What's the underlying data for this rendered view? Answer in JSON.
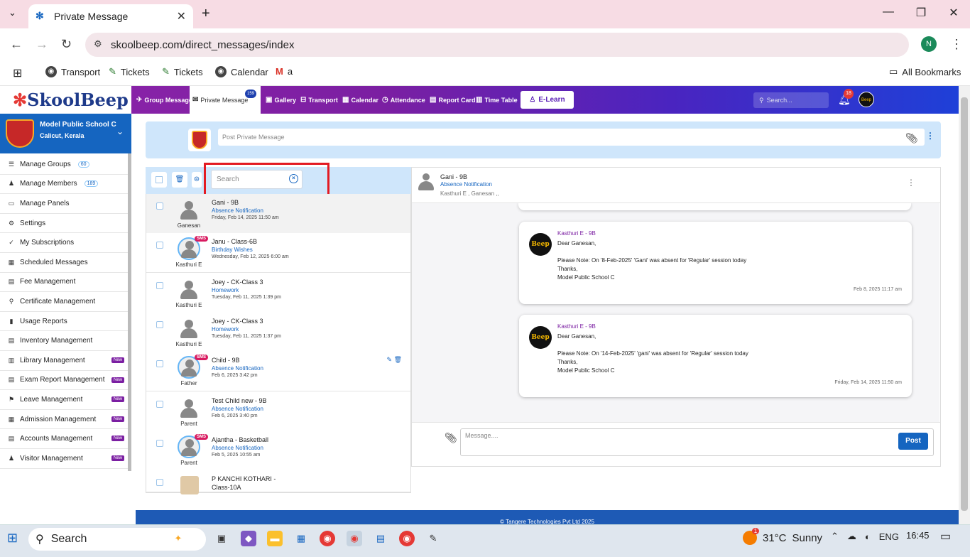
{
  "browser": {
    "tab_title": "Private Message",
    "url": "skoolbeep.com/direct_messages/index",
    "profile_initial": "N",
    "bookmarks": [
      "Transport",
      "Tickets",
      "Tickets",
      "Calendar",
      "a"
    ],
    "all_bookmarks": "All Bookmarks"
  },
  "app": {
    "logo_k": "✻",
    "logo_text": "SkoolBeep",
    "nav": [
      {
        "icon": "✈",
        "label": "Group Message"
      },
      {
        "icon": "✉",
        "label": "Private Message",
        "badge": "159"
      },
      {
        "icon": "▣",
        "label": "Gallery"
      },
      {
        "icon": "⊟",
        "label": "Transport"
      },
      {
        "icon": "▦",
        "label": "Calendar"
      },
      {
        "icon": "◷",
        "label": "Attendance"
      },
      {
        "icon": "▤",
        "label": "Report Card"
      },
      {
        "icon": "▥",
        "label": "Time Table"
      }
    ],
    "elearn": "E-Learn",
    "search_placeholder": "Search...",
    "notif_count": "18",
    "avatar_text": "Beep"
  },
  "school": {
    "name": "Model Public School C",
    "location": "Calicut, Kerala"
  },
  "sidebar": [
    {
      "icon": "☰",
      "label": "Manage Groups",
      "count": "60"
    },
    {
      "icon": "♟",
      "label": "Manage Members",
      "count": "189"
    },
    {
      "icon": "▭",
      "label": "Manage Panels"
    },
    {
      "icon": "⚙",
      "label": "Settings"
    },
    {
      "icon": "✓",
      "label": "My Subscriptions"
    },
    {
      "icon": "▦",
      "label": "Scheduled Messages"
    },
    {
      "icon": "▤",
      "label": "Fee Management"
    },
    {
      "icon": "⚲",
      "label": "Certificate Management"
    },
    {
      "icon": "▮",
      "label": "Usage Reports"
    },
    {
      "icon": "▤",
      "label": "Inventory Management"
    },
    {
      "icon": "▥",
      "label": "Library Management",
      "new": "New"
    },
    {
      "icon": "▤",
      "label": "Exam Report Management",
      "new": "New"
    },
    {
      "icon": "⚑",
      "label": "Leave Management",
      "new": "New"
    },
    {
      "icon": "▦",
      "label": "Admission Management",
      "new": "New"
    },
    {
      "icon": "▤",
      "label": "Accounts Management",
      "new": "New"
    },
    {
      "icon": "♟",
      "label": "Visitor Management",
      "new": "New"
    }
  ],
  "composer": {
    "placeholder": "Post Private Message"
  },
  "list": {
    "search_placeholder": "Search",
    "rows": [
      {
        "title": "Gani - 9B",
        "category": "Absence Notification",
        "date": "Friday, Feb 14, 2025 11:50 am",
        "who": "Ganesan",
        "sms": false
      },
      {
        "title": "Janu - Class-6B",
        "category": "Birthday Wishes",
        "date": "Wednesday, Feb 12, 2025 6:00 am",
        "who": "Kasthuri E",
        "sms": true
      },
      {
        "title": "Joey - CK-Class 3",
        "category": "Homework",
        "date": "Tuesday, Feb 11, 2025 1:39 pm",
        "who": "Kasthuri E",
        "sms": false
      },
      {
        "title": "Joey - CK-Class 3",
        "category": "Homework",
        "date": "Tuesday, Feb 11, 2025 1:37 pm",
        "who": "Kasthuri E",
        "sms": false
      },
      {
        "title": "Child - 9B",
        "category": "Absence Notification",
        "date": "Feb 6, 2025 3:42 pm",
        "who": "Father",
        "sms": true
      },
      {
        "title": "Test Child new - 9B",
        "category": "Absence Notification",
        "date": "Feb 6, 2025 3:40 pm",
        "who": "Parent",
        "sms": false
      },
      {
        "title": "Ajantha - Basketball",
        "category": "Absence Notification",
        "date": "Feb 5, 2025 10:55 am",
        "who": "Parent",
        "sms": true
      },
      {
        "title": "P KANCHI KOTHARI -",
        "category": "Class-10A",
        "date": "",
        "who": "",
        "sms": false
      }
    ],
    "sms_label": "SMS"
  },
  "conversation": {
    "title": "Gani - 9B",
    "category": "Absence Notification",
    "participants": "Kasthuri E , Ganesan ,,",
    "messages": [
      {
        "from": "Kasthuri E - 9B",
        "greet": "Dear Ganesan,",
        "body": "Please Note: On '8-Feb-2025' 'Gani' was absent for 'Regular' session today",
        "thanks": "Thanks,",
        "sign": "Model Public School C",
        "when": "Feb 8, 2025 11:17 am"
      },
      {
        "from": "Kasthuri E - 9B",
        "greet": "Dear Ganesan,",
        "body": "Please Note: On '14-Feb-2025' 'gani' was absent for 'Regular' session today",
        "thanks": "Thanks,",
        "sign": "Model Public School C",
        "when": "Friday, Feb 14, 2025 11:50 am"
      }
    ],
    "message_placeholder": "Message....",
    "post": "Post"
  },
  "footer": "© Tangere Technologies Pvt Ltd 2025",
  "taskbar": {
    "search": "Search",
    "temp": "31°C",
    "condition": "Sunny",
    "lang": "ENG",
    "time": "16:45",
    "weather_badge": "1"
  }
}
